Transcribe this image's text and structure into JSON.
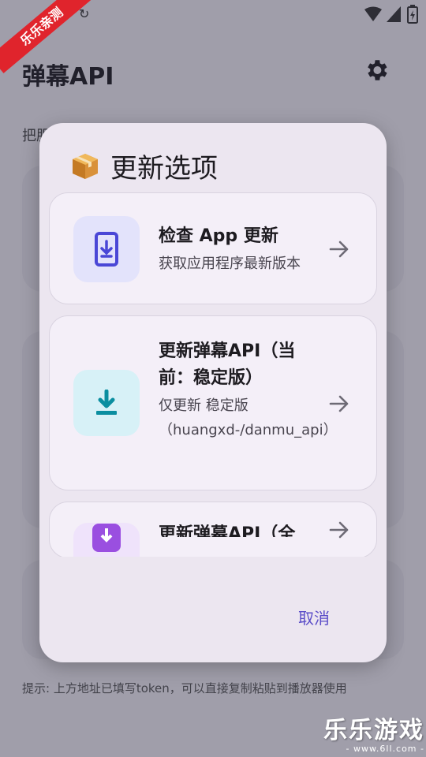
{
  "watermark": {
    "banner": "乐乐亲测",
    "brand": "乐乐游戏",
    "site": "- www.6ll.com -"
  },
  "background": {
    "title": "弹幕API",
    "section_label": "把服",
    "hint": "提示: 上方地址已填写token，可以直接复制粘贴到播放器使用"
  },
  "dialog": {
    "emoji": "📦",
    "title": "更新选项",
    "options": [
      {
        "title": "检查 App 更新",
        "subtitle": "获取应用程序最新版本",
        "icon": "phone-download-icon",
        "icon_bg": "#e3e3fb",
        "icon_color": "#4a47d6"
      },
      {
        "title": "更新弹幕API（当前：稳定版）",
        "subtitle": "仅更新 稳定版（huangxd-/danmu_api）",
        "icon": "download-icon",
        "icon_bg": "#d7f1f7",
        "icon_color": "#0a8ea0"
      },
      {
        "title": "更新弹幕API（全",
        "subtitle": "",
        "icon": "download-box-icon",
        "icon_bg": "#efe3fb",
        "icon_color": "#9a4fe0"
      }
    ],
    "cancel_label": "取消"
  }
}
